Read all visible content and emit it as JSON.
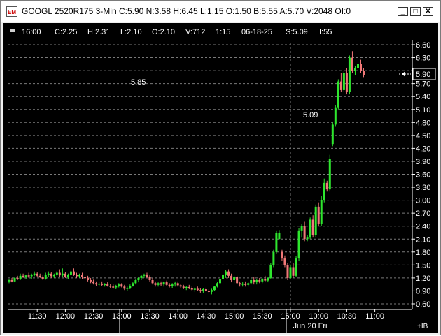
{
  "window": {
    "title": "GOOGL 2520R175 3-Min C:5.90 N:3.58 H:6.45 L:1.15 O:1.50 B:5.55 A:5.70 V:2048 OI:0",
    "app_icon_text": "EM",
    "min_glyph": "_",
    "max_glyph": "□",
    "close_glyph": "✕"
  },
  "info_bar": {
    "time": "16:00",
    "close": "C:2.25",
    "high": "H:2.31",
    "low": "L:2.10",
    "open": "O:2.10",
    "volume": "V:712",
    "interval": "1:15",
    "date": "06-18-25",
    "strike": "S:5.09",
    "index": "I:55"
  },
  "annotations": {
    "left_marker": "5.85",
    "mid_marker": "5.09",
    "price_tag": "5.90",
    "corner": "+IB"
  },
  "colors": {
    "background": "#000000",
    "up": "#2ee62e",
    "down": "#f07878",
    "grid": "#7a7a7a",
    "text": "#ffffff"
  },
  "chart_data": {
    "type": "candlestick",
    "y_ticks": [
      "6.60",
      "6.30",
      "6.00",
      "5.70",
      "5.40",
      "5.10",
      "4.80",
      "4.50",
      "4.20",
      "3.90",
      "3.60",
      "3.30",
      "3.00",
      "2.70",
      "2.40",
      "2.10",
      "1.80",
      "1.50",
      "1.20",
      "0.90",
      "0.60"
    ],
    "ylim": [
      0.6,
      6.6
    ],
    "x_ticks": [
      {
        "i": 10,
        "label": "11:30"
      },
      {
        "i": 20,
        "label": "12:00"
      },
      {
        "i": 30,
        "label": "12:30"
      },
      {
        "i": 40,
        "label": "13:00"
      },
      {
        "i": 50,
        "label": "13:30"
      },
      {
        "i": 60,
        "label": "14:00"
      },
      {
        "i": 70,
        "label": "14:30"
      },
      {
        "i": 80,
        "label": "15:00"
      },
      {
        "i": 90,
        "label": "15:30"
      },
      {
        "i": 100,
        "label": "16:00"
      },
      {
        "i": 110,
        "label": "10:00"
      },
      {
        "i": 120,
        "label": "10:30"
      },
      {
        "i": 130,
        "label": "11:00"
      }
    ],
    "day_label": "Jun 20 Fri",
    "day_break_index": 100,
    "current_price": 5.9,
    "candles": [
      {
        "o": 1.12,
        "h": 1.18,
        "l": 1.08,
        "c": 1.15
      },
      {
        "o": 1.15,
        "h": 1.2,
        "l": 1.1,
        "c": 1.12
      },
      {
        "o": 1.12,
        "h": 1.22,
        "l": 1.1,
        "c": 1.2
      },
      {
        "o": 1.2,
        "h": 1.25,
        "l": 1.15,
        "c": 1.18
      },
      {
        "o": 1.18,
        "h": 1.3,
        "l": 1.15,
        "c": 1.25
      },
      {
        "o": 1.25,
        "h": 1.3,
        "l": 1.2,
        "c": 1.22
      },
      {
        "o": 1.22,
        "h": 1.28,
        "l": 1.18,
        "c": 1.26
      },
      {
        "o": 1.26,
        "h": 1.32,
        "l": 1.2,
        "c": 1.24
      },
      {
        "o": 1.24,
        "h": 1.3,
        "l": 1.18,
        "c": 1.28
      },
      {
        "o": 1.28,
        "h": 1.35,
        "l": 1.24,
        "c": 1.3
      },
      {
        "o": 1.3,
        "h": 1.34,
        "l": 1.22,
        "c": 1.25
      },
      {
        "o": 1.25,
        "h": 1.3,
        "l": 1.2,
        "c": 1.22
      },
      {
        "o": 1.22,
        "h": 1.26,
        "l": 1.15,
        "c": 1.18
      },
      {
        "o": 1.18,
        "h": 1.32,
        "l": 1.16,
        "c": 1.28
      },
      {
        "o": 1.28,
        "h": 1.35,
        "l": 1.22,
        "c": 1.3
      },
      {
        "o": 1.3,
        "h": 1.34,
        "l": 1.2,
        "c": 1.24
      },
      {
        "o": 1.24,
        "h": 1.3,
        "l": 1.2,
        "c": 1.28
      },
      {
        "o": 1.28,
        "h": 1.36,
        "l": 1.24,
        "c": 1.32
      },
      {
        "o": 1.32,
        "h": 1.4,
        "l": 1.22,
        "c": 1.26
      },
      {
        "o": 1.26,
        "h": 1.42,
        "l": 1.22,
        "c": 1.3
      },
      {
        "o": 1.3,
        "h": 1.34,
        "l": 1.2,
        "c": 1.22
      },
      {
        "o": 1.22,
        "h": 1.3,
        "l": 1.18,
        "c": 1.28
      },
      {
        "o": 1.28,
        "h": 1.4,
        "l": 1.25,
        "c": 1.35
      },
      {
        "o": 1.35,
        "h": 1.42,
        "l": 1.25,
        "c": 1.28
      },
      {
        "o": 1.28,
        "h": 1.32,
        "l": 1.2,
        "c": 1.24
      },
      {
        "o": 1.24,
        "h": 1.3,
        "l": 1.2,
        "c": 1.27
      },
      {
        "o": 1.27,
        "h": 1.32,
        "l": 1.18,
        "c": 1.22
      },
      {
        "o": 1.22,
        "h": 1.28,
        "l": 1.15,
        "c": 1.2
      },
      {
        "o": 1.2,
        "h": 1.25,
        "l": 1.12,
        "c": 1.15
      },
      {
        "o": 1.15,
        "h": 1.2,
        "l": 1.08,
        "c": 1.12
      },
      {
        "o": 1.12,
        "h": 1.16,
        "l": 1.05,
        "c": 1.08
      },
      {
        "o": 1.08,
        "h": 1.12,
        "l": 1.02,
        "c": 1.05
      },
      {
        "o": 1.05,
        "h": 1.1,
        "l": 1.0,
        "c": 1.07
      },
      {
        "o": 1.07,
        "h": 1.12,
        "l": 1.02,
        "c": 1.04
      },
      {
        "o": 1.04,
        "h": 1.08,
        "l": 1.0,
        "c": 1.06
      },
      {
        "o": 1.06,
        "h": 1.1,
        "l": 1.0,
        "c": 1.02
      },
      {
        "o": 1.02,
        "h": 1.06,
        "l": 0.97,
        "c": 1.0
      },
      {
        "o": 1.0,
        "h": 1.05,
        "l": 0.95,
        "c": 0.98
      },
      {
        "o": 0.98,
        "h": 1.04,
        "l": 0.94,
        "c": 1.02
      },
      {
        "o": 1.02,
        "h": 1.08,
        "l": 0.98,
        "c": 1.05
      },
      {
        "o": 1.05,
        "h": 1.08,
        "l": 0.98,
        "c": 1.0
      },
      {
        "o": 1.0,
        "h": 1.04,
        "l": 0.92,
        "c": 0.95
      },
      {
        "o": 0.95,
        "h": 1.0,
        "l": 0.9,
        "c": 0.97
      },
      {
        "o": 0.97,
        "h": 1.05,
        "l": 0.94,
        "c": 1.02
      },
      {
        "o": 1.02,
        "h": 1.1,
        "l": 1.0,
        "c": 1.08
      },
      {
        "o": 1.08,
        "h": 1.18,
        "l": 1.05,
        "c": 1.15
      },
      {
        "o": 1.15,
        "h": 1.22,
        "l": 1.1,
        "c": 1.2
      },
      {
        "o": 1.2,
        "h": 1.28,
        "l": 1.15,
        "c": 1.25
      },
      {
        "o": 1.25,
        "h": 1.3,
        "l": 1.2,
        "c": 1.28
      },
      {
        "o": 1.28,
        "h": 1.32,
        "l": 1.2,
        "c": 1.22
      },
      {
        "o": 1.22,
        "h": 1.26,
        "l": 1.12,
        "c": 1.15
      },
      {
        "o": 1.15,
        "h": 1.2,
        "l": 1.05,
        "c": 1.08
      },
      {
        "o": 1.08,
        "h": 1.12,
        "l": 1.0,
        "c": 1.04
      },
      {
        "o": 1.04,
        "h": 1.1,
        "l": 1.0,
        "c": 1.08
      },
      {
        "o": 1.08,
        "h": 1.12,
        "l": 1.02,
        "c": 1.05
      },
      {
        "o": 1.05,
        "h": 1.12,
        "l": 1.0,
        "c": 1.1
      },
      {
        "o": 1.1,
        "h": 1.14,
        "l": 1.02,
        "c": 1.04
      },
      {
        "o": 1.04,
        "h": 1.08,
        "l": 0.98,
        "c": 1.02
      },
      {
        "o": 1.02,
        "h": 1.08,
        "l": 0.96,
        "c": 1.05
      },
      {
        "o": 1.05,
        "h": 1.12,
        "l": 1.0,
        "c": 1.08
      },
      {
        "o": 1.08,
        "h": 1.12,
        "l": 1.0,
        "c": 1.03
      },
      {
        "o": 1.03,
        "h": 1.06,
        "l": 0.96,
        "c": 1.0
      },
      {
        "o": 1.0,
        "h": 1.04,
        "l": 0.94,
        "c": 0.97
      },
      {
        "o": 0.97,
        "h": 1.02,
        "l": 0.92,
        "c": 0.99
      },
      {
        "o": 0.99,
        "h": 1.04,
        "l": 0.94,
        "c": 0.96
      },
      {
        "o": 0.96,
        "h": 1.0,
        "l": 0.9,
        "c": 0.93
      },
      {
        "o": 0.93,
        "h": 0.98,
        "l": 0.88,
        "c": 0.95
      },
      {
        "o": 0.95,
        "h": 1.0,
        "l": 0.9,
        "c": 0.92
      },
      {
        "o": 0.92,
        "h": 0.96,
        "l": 0.86,
        "c": 0.9
      },
      {
        "o": 0.9,
        "h": 0.96,
        "l": 0.86,
        "c": 0.94
      },
      {
        "o": 0.94,
        "h": 0.98,
        "l": 0.88,
        "c": 0.9
      },
      {
        "o": 0.9,
        "h": 0.94,
        "l": 0.84,
        "c": 0.88
      },
      {
        "o": 0.88,
        "h": 0.95,
        "l": 0.82,
        "c": 0.92
      },
      {
        "o": 0.92,
        "h": 1.02,
        "l": 0.9,
        "c": 1.0
      },
      {
        "o": 1.0,
        "h": 1.1,
        "l": 0.98,
        "c": 1.08
      },
      {
        "o": 1.08,
        "h": 1.2,
        "l": 1.05,
        "c": 1.18
      },
      {
        "o": 1.18,
        "h": 1.3,
        "l": 1.1,
        "c": 1.28
      },
      {
        "o": 1.28,
        "h": 1.38,
        "l": 1.2,
        "c": 1.35
      },
      {
        "o": 1.35,
        "h": 1.4,
        "l": 1.2,
        "c": 1.25
      },
      {
        "o": 1.25,
        "h": 1.3,
        "l": 1.1,
        "c": 1.15
      },
      {
        "o": 1.15,
        "h": 1.25,
        "l": 1.08,
        "c": 1.22
      },
      {
        "o": 1.22,
        "h": 1.25,
        "l": 1.05,
        "c": 1.08
      },
      {
        "o": 1.08,
        "h": 1.12,
        "l": 1.0,
        "c": 1.05
      },
      {
        "o": 1.05,
        "h": 1.1,
        "l": 1.0,
        "c": 1.07
      },
      {
        "o": 1.07,
        "h": 1.12,
        "l": 1.0,
        "c": 1.04
      },
      {
        "o": 1.04,
        "h": 1.1,
        "l": 1.0,
        "c": 1.08
      },
      {
        "o": 1.08,
        "h": 1.2,
        "l": 1.05,
        "c": 1.15
      },
      {
        "o": 1.15,
        "h": 1.22,
        "l": 1.05,
        "c": 1.1
      },
      {
        "o": 1.1,
        "h": 1.18,
        "l": 1.05,
        "c": 1.15
      },
      {
        "o": 1.15,
        "h": 1.2,
        "l": 1.08,
        "c": 1.12
      },
      {
        "o": 1.12,
        "h": 1.2,
        "l": 1.08,
        "c": 1.18
      },
      {
        "o": 1.18,
        "h": 1.25,
        "l": 1.1,
        "c": 1.14
      },
      {
        "o": 1.14,
        "h": 1.22,
        "l": 1.1,
        "c": 1.2
      },
      {
        "o": 1.2,
        "h": 1.55,
        "l": 1.18,
        "c": 1.5
      },
      {
        "o": 1.5,
        "h": 1.85,
        "l": 1.45,
        "c": 1.8
      },
      {
        "o": 1.8,
        "h": 2.3,
        "l": 1.75,
        "c": 2.25
      },
      {
        "o": 2.1,
        "h": 2.31,
        "l": 2.1,
        "c": 2.25
      },
      {
        "o": 1.8,
        "h": 1.85,
        "l": 1.6,
        "c": 1.65
      },
      {
        "o": 1.65,
        "h": 1.72,
        "l": 1.45,
        "c": 1.5
      },
      {
        "o": 1.5,
        "h": 1.55,
        "l": 1.15,
        "c": 1.2
      },
      {
        "o": 1.2,
        "h": 1.5,
        "l": 1.18,
        "c": 1.45
      },
      {
        "o": 1.45,
        "h": 1.55,
        "l": 1.2,
        "c": 1.25
      },
      {
        "o": 1.25,
        "h": 1.7,
        "l": 1.22,
        "c": 1.65
      },
      {
        "o": 1.65,
        "h": 2.35,
        "l": 1.6,
        "c": 2.3
      },
      {
        "o": 2.3,
        "h": 2.45,
        "l": 2.15,
        "c": 2.4
      },
      {
        "o": 2.4,
        "h": 2.5,
        "l": 2.05,
        "c": 2.1
      },
      {
        "o": 2.1,
        "h": 2.2,
        "l": 2.05,
        "c": 2.15
      },
      {
        "o": 2.15,
        "h": 2.6,
        "l": 2.1,
        "c": 2.55
      },
      {
        "o": 2.55,
        "h": 2.65,
        "l": 2.15,
        "c": 2.2
      },
      {
        "o": 2.2,
        "h": 2.9,
        "l": 2.15,
        "c": 2.85
      },
      {
        "o": 2.85,
        "h": 2.95,
        "l": 2.4,
        "c": 2.45
      },
      {
        "o": 2.45,
        "h": 3.1,
        "l": 2.4,
        "c": 3.0
      },
      {
        "o": 3.0,
        "h": 3.5,
        "l": 2.95,
        "c": 3.4
      },
      {
        "o": 3.4,
        "h": 3.45,
        "l": 3.2,
        "c": 3.25
      },
      {
        "o": 3.25,
        "h": 4.05,
        "l": 3.2,
        "c": 3.95
      },
      {
        "o": 4.3,
        "h": 4.8,
        "l": 4.25,
        "c": 4.75
      },
      {
        "o": 4.75,
        "h": 5.2,
        "l": 4.7,
        "c": 5.15
      },
      {
        "o": 5.15,
        "h": 5.8,
        "l": 5.1,
        "c": 5.75
      },
      {
        "o": 5.75,
        "h": 5.95,
        "l": 5.5,
        "c": 5.55
      },
      {
        "o": 5.55,
        "h": 6.0,
        "l": 5.5,
        "c": 5.95
      },
      {
        "o": 5.95,
        "h": 6.05,
        "l": 5.45,
        "c": 5.5
      },
      {
        "o": 5.5,
        "h": 6.35,
        "l": 5.45,
        "c": 6.3
      },
      {
        "o": 6.3,
        "h": 6.45,
        "l": 5.95,
        "c": 6.0
      },
      {
        "o": 6.0,
        "h": 6.1,
        "l": 5.9,
        "c": 6.05
      },
      {
        "o": 6.05,
        "h": 6.2,
        "l": 6.0,
        "c": 6.15
      },
      {
        "o": 6.15,
        "h": 6.25,
        "l": 5.95,
        "c": 6.0
      },
      {
        "o": 6.0,
        "h": 6.05,
        "l": 5.85,
        "c": 5.9
      }
    ]
  }
}
